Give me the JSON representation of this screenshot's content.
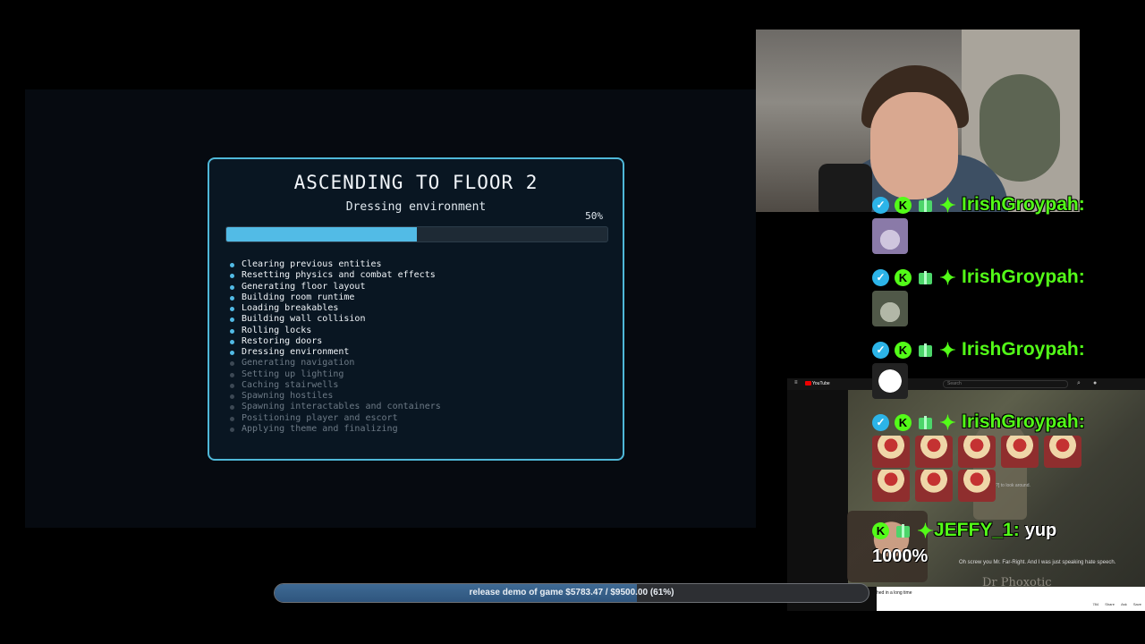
{
  "loading_screen": {
    "title": "ASCENDING TO FLOOR 2",
    "subtitle": "Dressing environment",
    "progress_percent_label": "50%",
    "progress_fraction": 0.5,
    "steps": [
      {
        "label": "Clearing previous entities",
        "done": true
      },
      {
        "label": "Resetting physics and combat effects",
        "done": true
      },
      {
        "label": "Generating floor layout",
        "done": true
      },
      {
        "label": "Building room runtime",
        "done": true
      },
      {
        "label": "Loading breakables",
        "done": true
      },
      {
        "label": "Building wall collision",
        "done": true
      },
      {
        "label": "Rolling locks",
        "done": true
      },
      {
        "label": "Restoring doors",
        "done": true
      },
      {
        "label": "Dressing environment",
        "done": true
      },
      {
        "label": "Generating navigation",
        "done": false
      },
      {
        "label": "Setting up lighting",
        "done": false
      },
      {
        "label": "Caching stairwells",
        "done": false
      },
      {
        "label": "Spawning hostiles",
        "done": false
      },
      {
        "label": "Spawning interactables and containers",
        "done": false
      },
      {
        "label": "Positioning player and escort",
        "done": false
      },
      {
        "label": "Applying theme and finalizing",
        "done": false
      }
    ]
  },
  "chat": {
    "messages": [
      {
        "username": "IrishGroypah:",
        "emote": "rabbit-emote"
      },
      {
        "username": "IrishGroypah:",
        "emote": "bunny-emote"
      },
      {
        "username": "IrishGroypah:",
        "emote": "troll-face-emote"
      },
      {
        "username": "IrishGroypah:",
        "emote": "hat-emote-repeated",
        "emote_count": 8
      },
      {
        "username": "JEFFY_1:",
        "text": "yup",
        "amount": "1000%"
      }
    ],
    "badges": [
      "verified-icon",
      "kick-icon",
      "gift-icon",
      "sub-icon"
    ]
  },
  "youtube": {
    "logo": "YouTube",
    "search_placeholder": "Search",
    "caption_top": "Use [???] to look around.",
    "caption_bottom": "Oh screw you Mr. Far-Right. And I was just speaking hate speech.",
    "watermark": "Dr Phoxotic",
    "video_title": "hed in a long time",
    "actions": [
      "784",
      "Share",
      "Ask",
      "Save"
    ]
  },
  "donation_goal": {
    "label": "release demo of game $5783.47 / $9500.00 (61%)",
    "fraction": 0.61
  },
  "colors": {
    "accent": "#52bbe6",
    "panel_border": "#4fb8d8",
    "chat_username": "#53fc18",
    "goal_fill": "#2f557e"
  }
}
